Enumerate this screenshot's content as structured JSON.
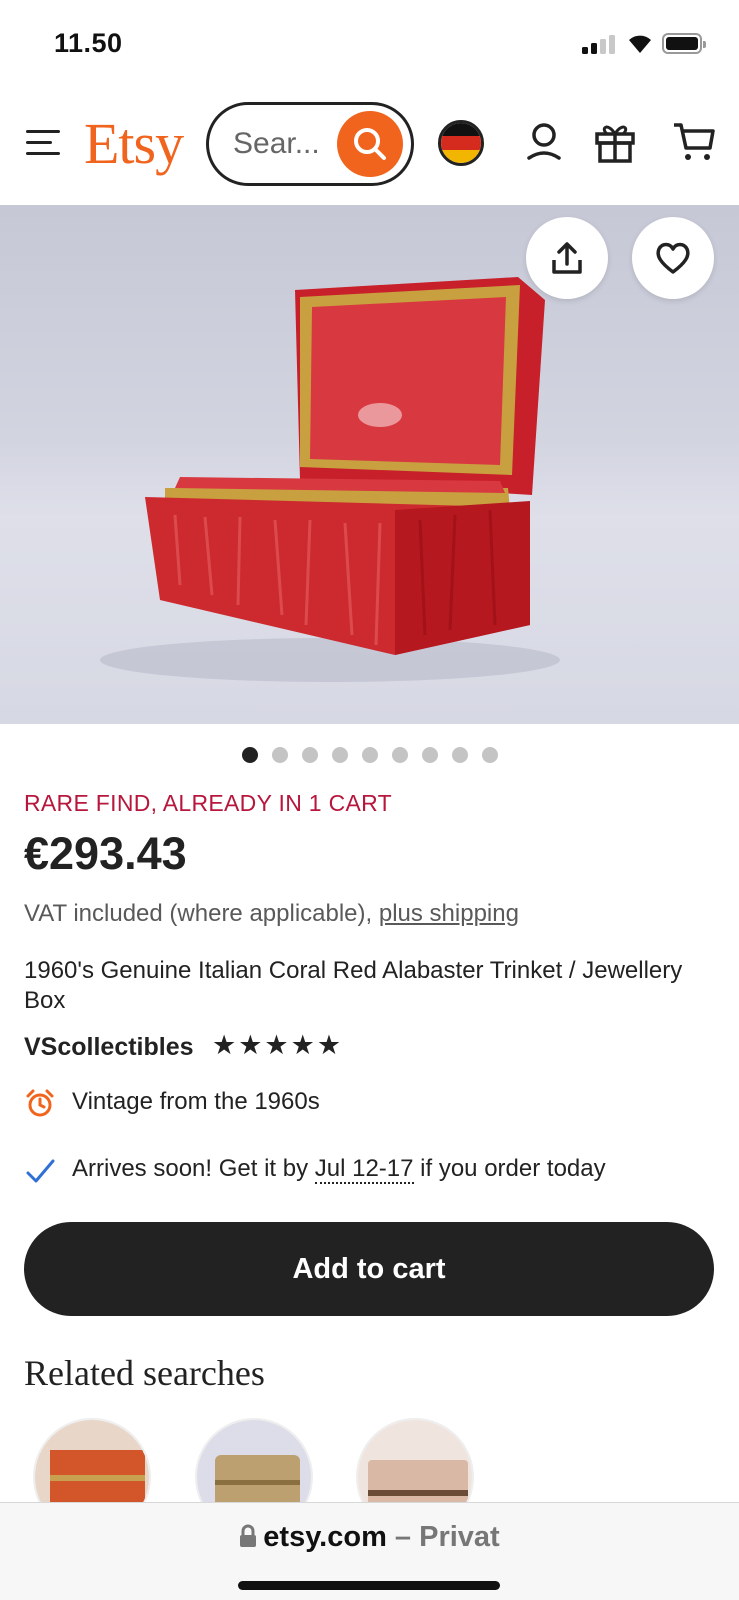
{
  "status_bar": {
    "time": "11.50"
  },
  "header": {
    "logo": "Etsy",
    "search_placeholder": "Sear..."
  },
  "gallery": {
    "image_count": 9,
    "active_index": 0
  },
  "product": {
    "urgency": "RARE FIND, ALREADY IN 1 CART",
    "price": "€293.43",
    "vat_text": "VAT included (where applicable), ",
    "shipping_link": "plus shipping",
    "title": "1960's Genuine Italian Coral Red Alabaster Trinket / Jewellery Box",
    "seller": "VScollectibles",
    "rating_stars": "★★★★★",
    "rating": 5,
    "vintage_text": "Vintage from the 1960s",
    "arrival_prefix": "Arrives soon! Get it by ",
    "arrival_dates": "Jul 12-17",
    "arrival_suffix": " if you order today"
  },
  "actions": {
    "add_to_cart": "Add to cart"
  },
  "related": {
    "heading": "Related searches"
  },
  "browser": {
    "domain": "etsy.com",
    "separator": " – ",
    "mode": "Privat"
  },
  "colors": {
    "brand_orange": "#f1641e",
    "urgency_red": "#b7173d",
    "button_dark": "#222222",
    "check_blue": "#2f6fd6"
  }
}
